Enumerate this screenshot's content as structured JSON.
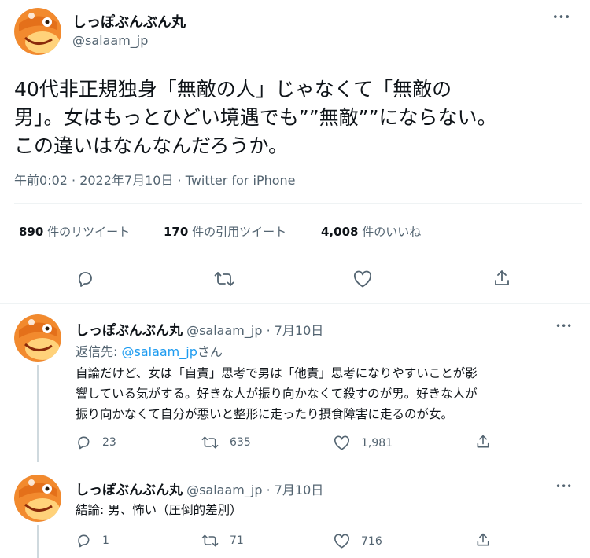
{
  "main_tweet": {
    "author_name": "しっぽぶんぶん丸",
    "author_handle": "@salaam_jp",
    "text_lines": [
      "40代非正規独身「無敵の人」じゃなくて「無敵の",
      "男」。女はもっとひどい境遇でも””無敵””にならない。",
      "この違いはなんなんだろうか。"
    ],
    "meta": "午前0:02 · 2022年7月10日 · Twitter for iPhone",
    "stats": {
      "retweets_count": "890",
      "retweets_label": "件のリツイート",
      "quotes_count": "170",
      "quotes_label": "件の引用ツイート",
      "likes_count": "4,008",
      "likes_label": "件のいいね"
    }
  },
  "replies": [
    {
      "author_name": "しっぽぶんぶん丸",
      "author_handle": "@salaam_jp",
      "date": "7月10日",
      "reply_to_prefix": "返信先: ",
      "reply_to_handle": "@salaam_jp",
      "reply_to_suffix": "さん",
      "text_lines": [
        "自論だけど、女は「自責」思考で男は「他責」思考になりやすいことが影",
        "響している気がする。好きな人が振り向かなくて殺すのが男。好きな人が",
        "振り向かなくて自分が悪いと整形に走ったり摂食障害に走るのが女。"
      ],
      "reply_count": "23",
      "retweet_count": "635",
      "like_count": "1,981"
    },
    {
      "author_name": "しっぽぶんぶん丸",
      "author_handle": "@salaam_jp",
      "date": "7月10日",
      "text_lines": [
        "結論: 男、怖い（圧倒的差別）"
      ],
      "reply_count": "1",
      "retweet_count": "71",
      "like_count": "716"
    }
  ],
  "separator": " · ",
  "more_glyph": "•••",
  "icons": [
    "avatar-orange-lizard",
    "reply-icon",
    "retweet-icon",
    "like-icon",
    "share-icon",
    "more-icon"
  ],
  "colors": {
    "link": "#1d9bf0",
    "muted": "#536471",
    "text": "#0f1419",
    "avatar": "#f28a2e"
  }
}
